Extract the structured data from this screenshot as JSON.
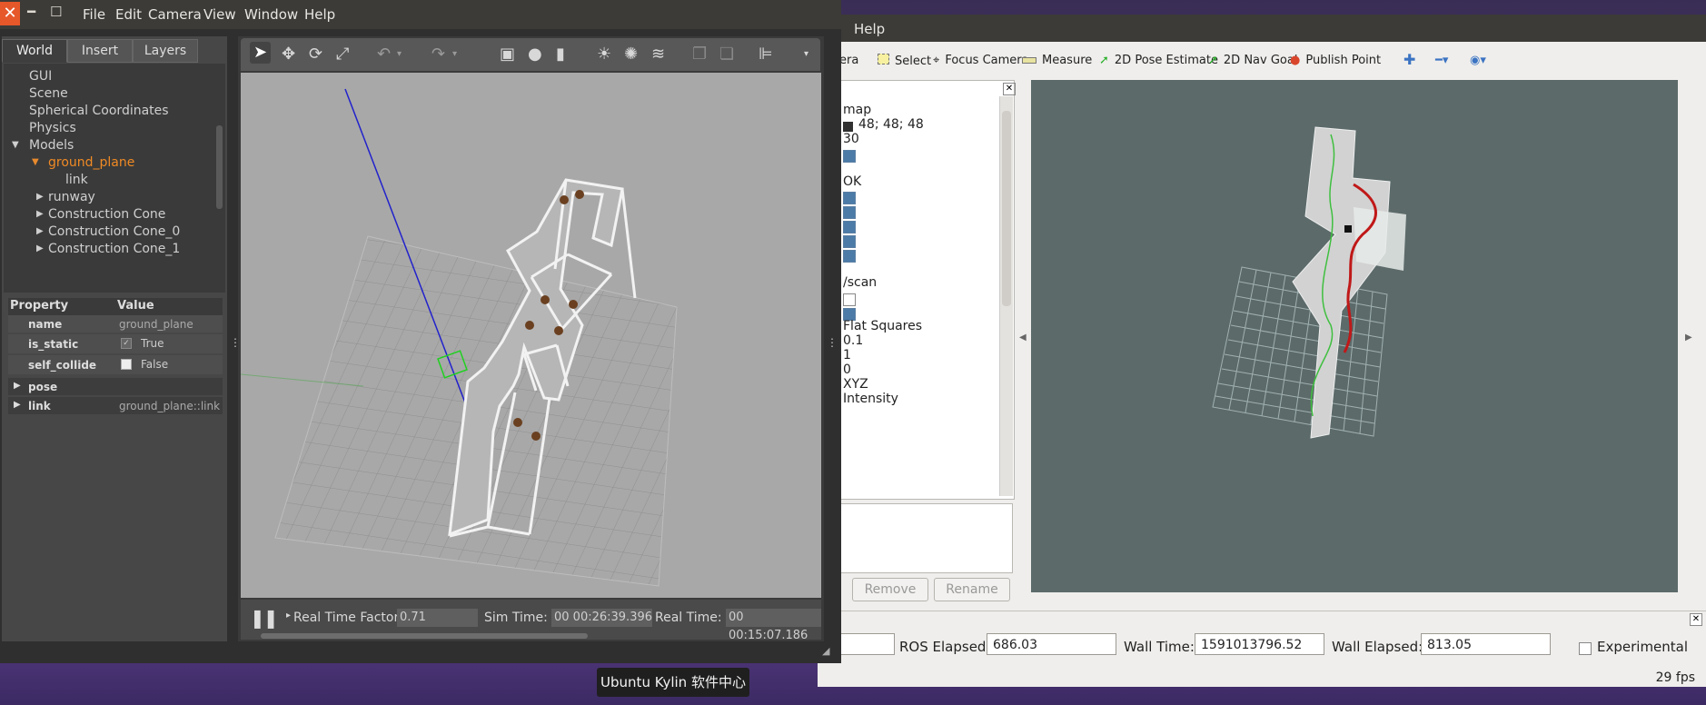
{
  "rviz": {
    "menu_help": "Help",
    "toolbar": {
      "camera_partial": "era",
      "select": "Select",
      "focus_camera": "Focus Camera",
      "measure": "Measure",
      "pose_estimate": "2D Pose Estimate",
      "nav_goal": "2D Nav Goal",
      "publish_point": "Publish Point"
    },
    "displays": {
      "map_topic": "map",
      "map_color": "48; 48; 48",
      "map_alpha": "30",
      "status_ok": "OK",
      "scan_topic": "/scan",
      "style": "Flat Squares",
      "size": "0.1",
      "decay": "1",
      "queue": "0",
      "position_transformer": "XYZ",
      "color_transformer": "Intensity"
    },
    "buttons": {
      "remove": "Remove",
      "rename": "Rename"
    },
    "status": {
      "ros_elapsed_label": "ROS Elapsed:",
      "ros_elapsed": "686.03",
      "wall_time_label": "Wall Time:",
      "wall_time": "1591013796.52",
      "wall_elapsed_label": "Wall Elapsed:",
      "wall_elapsed": "813.05",
      "experimental_label": "Experimental",
      "fps": "29 fps"
    }
  },
  "gazebo": {
    "menu": [
      "File",
      "Edit",
      "Camera",
      "View",
      "Window",
      "Help"
    ],
    "tabs": [
      "World",
      "Insert",
      "Layers"
    ],
    "tree": {
      "gui": "GUI",
      "scene": "Scene",
      "spherical": "Spherical Coordinates",
      "physics": "Physics",
      "models": "Models",
      "ground_plane": "ground_plane",
      "link": "link",
      "runway": "runway",
      "cone": "Construction Cone",
      "cone0": "Construction Cone_0",
      "cone1": "Construction Cone_1"
    },
    "props": {
      "col_property": "Property",
      "col_value": "Value",
      "name_key": "name",
      "name_val": "ground_plane",
      "static_key": "is_static",
      "static_val": "True",
      "collide_key": "self_collide",
      "collide_val": "False",
      "pose_key": "pose",
      "link_key": "link",
      "link_val": "ground_plane::link"
    },
    "bottom": {
      "rtf_label": "Real Time Factor:",
      "rtf": "0.71",
      "sim_label": "Sim Time:",
      "sim": "00 00:26:39.396",
      "real_label": "Real Time:",
      "real": "00 00:15:07.186"
    }
  },
  "tooltip": "Ubuntu Kylin 软件中心"
}
